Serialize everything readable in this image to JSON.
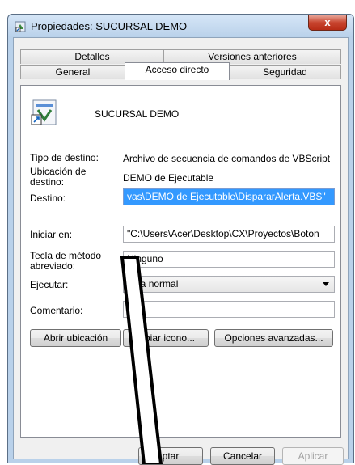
{
  "window": {
    "title": "Propiedades: SUCURSAL DEMO",
    "close_label": "x"
  },
  "tabs": {
    "row1": [
      "Detalles",
      "Versiones anteriores"
    ],
    "row2": [
      "General",
      "Acceso directo",
      "Seguridad"
    ],
    "active": "Acceso directo"
  },
  "shortcut": {
    "name": "SUCURSAL DEMO",
    "target_type_label": "Tipo de destino:",
    "target_type_value": "Archivo de secuencia de comandos de VBScript",
    "location_label": "Ubicación de destino:",
    "location_value": "DEMO de Ejecutable",
    "target_label": "Destino:",
    "target_value": "vas\\DEMO de Ejecutable\\DispararAlerta.VBS\"",
    "start_in_label": "Iniciar en:",
    "start_in_value": "\"C:\\Users\\Acer\\Desktop\\CX\\Proyectos\\Boton",
    "hotkey_label": "Tecla de método abreviado:",
    "hotkey_value": "Ninguno",
    "run_label": "Ejecutar:",
    "run_value": "tana normal",
    "comment_label": "Comentario:",
    "comment_value": ""
  },
  "buttons": {
    "open_location": "Abrir ubicación",
    "change_icon": "mbiar icono...",
    "advanced": "Opciones avanzadas...",
    "ok": "ptar",
    "cancel": "Cancelar",
    "apply": "Aplicar"
  },
  "colors": {
    "selection": "#3399ff",
    "titlebar": "#b9d1ea",
    "close": "#c8452f"
  }
}
